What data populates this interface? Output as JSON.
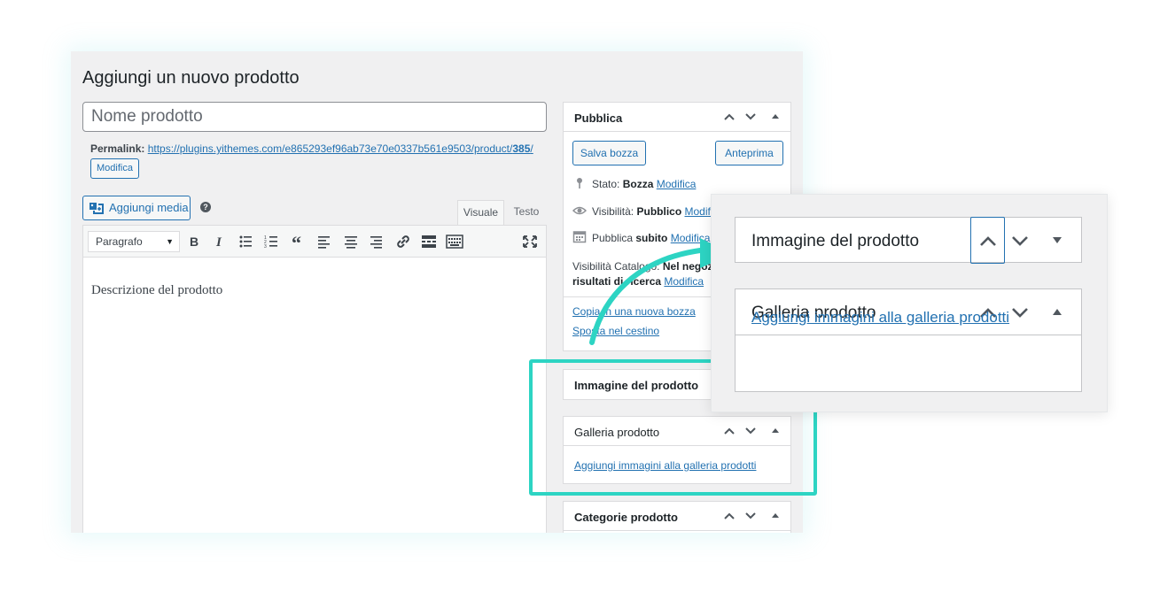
{
  "page": {
    "title": "Aggiungi un nuovo prodotto"
  },
  "title_field": {
    "placeholder": "Nome prodotto"
  },
  "permalink": {
    "label": "Permalink:",
    "url_base": "https://plugins.yithemes.com/e865293ef96ab73e70e0337b561e9503/product/",
    "url_id": "385",
    "edit_button": "Modifica"
  },
  "editor": {
    "add_media": "Aggiungi media",
    "tab_visual": "Visuale",
    "tab_text": "Testo",
    "format_select": "Paragrafo",
    "content": "Descrizione del prodotto",
    "toolbar_icons": [
      "bold-icon",
      "italic-icon",
      "bullet-list-icon",
      "numbered-list-icon",
      "blockquote-icon",
      "align-left-icon",
      "align-center-icon",
      "align-right-icon",
      "link-icon",
      "read-more-icon",
      "toolbar-toggle-icon",
      "fullscreen-icon"
    ]
  },
  "publish_box": {
    "title": "Pubblica",
    "save_draft": "Salva bozza",
    "preview": "Anteprima",
    "status_label": "Stato:",
    "status_value": "Bozza",
    "status_edit": "Modifica",
    "visibility_label": "Visibilità:",
    "visibility_value": "Pubblico",
    "visibility_edit": "Modifica",
    "publish_label": "Pubblica",
    "publish_value": "subito",
    "publish_edit": "Modifica",
    "catalog_label": "Visibilità Catalogo:",
    "catalog_value": "Nel negozio e nei risultati di ricerca",
    "catalog_edit": "Modifica",
    "copy_draft": "Copia in una nuova bozza",
    "trash": "Sposta nel cestino"
  },
  "image_box": {
    "title": "Immagine del prodotto"
  },
  "gallery_box": {
    "title": "Galleria prodotto",
    "add_link": "Aggiungi immagini alla galleria prodotti"
  },
  "categories_box": {
    "title": "Categorie prodotto"
  },
  "zoom": {
    "image_title": "Immagine del prodotto",
    "gallery_title": "Galleria prodotto",
    "gallery_link": "Aggiungi immagini alla galleria prodotti"
  },
  "colors": {
    "accent": "#2271b1",
    "highlight": "#2dd4c3",
    "danger": "#b32d2e"
  }
}
